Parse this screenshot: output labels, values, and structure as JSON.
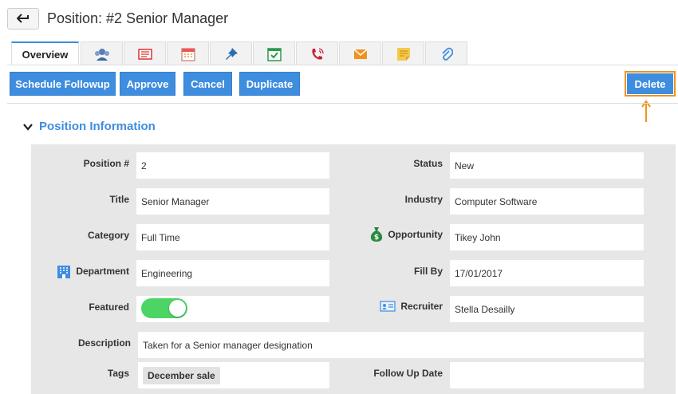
{
  "header": {
    "title": "Position: #2 Senior Manager"
  },
  "tabs": [
    {
      "label": "Overview",
      "icon": "overview"
    },
    {
      "icon": "contacts-icon"
    },
    {
      "icon": "notes-icon"
    },
    {
      "icon": "calendar-icon"
    },
    {
      "icon": "pin-icon"
    },
    {
      "icon": "task-icon"
    },
    {
      "icon": "call-icon"
    },
    {
      "icon": "email-icon"
    },
    {
      "icon": "sticky-note-icon"
    },
    {
      "icon": "attachment-icon"
    }
  ],
  "actions": {
    "schedule": "Schedule Followup",
    "approve": "Approve",
    "cancel": "Cancel",
    "duplicate": "Duplicate",
    "delete": "Delete"
  },
  "section": {
    "title": "Position Information"
  },
  "fields": {
    "position_label": "Position #",
    "position": "2",
    "status_label": "Status",
    "status": "New",
    "title_label": "Title",
    "title": "Senior Manager",
    "industry_label": "Industry",
    "industry": "Computer Software",
    "category_label": "Category",
    "category": "Full Time",
    "opportunity_label": "Opportunity",
    "opportunity": "Tikey John",
    "department_label": "Department",
    "department": "Engineering",
    "fillby_label": "Fill By",
    "fillby": "17/01/2017",
    "featured_label": "Featured",
    "featured": true,
    "recruiter_label": "Recruiter",
    "recruiter": "Stella Desailly",
    "description_label": "Description",
    "description": "Taken for a Senior manager designation",
    "tags_label": "Tags",
    "tag": "Dеcember sale",
    "followup_label": "Follow Up Date",
    "followup": ""
  },
  "colors": {
    "accent": "#3e8ddf",
    "highlight": "#f0921e",
    "toggle_on": "#4cd465"
  }
}
